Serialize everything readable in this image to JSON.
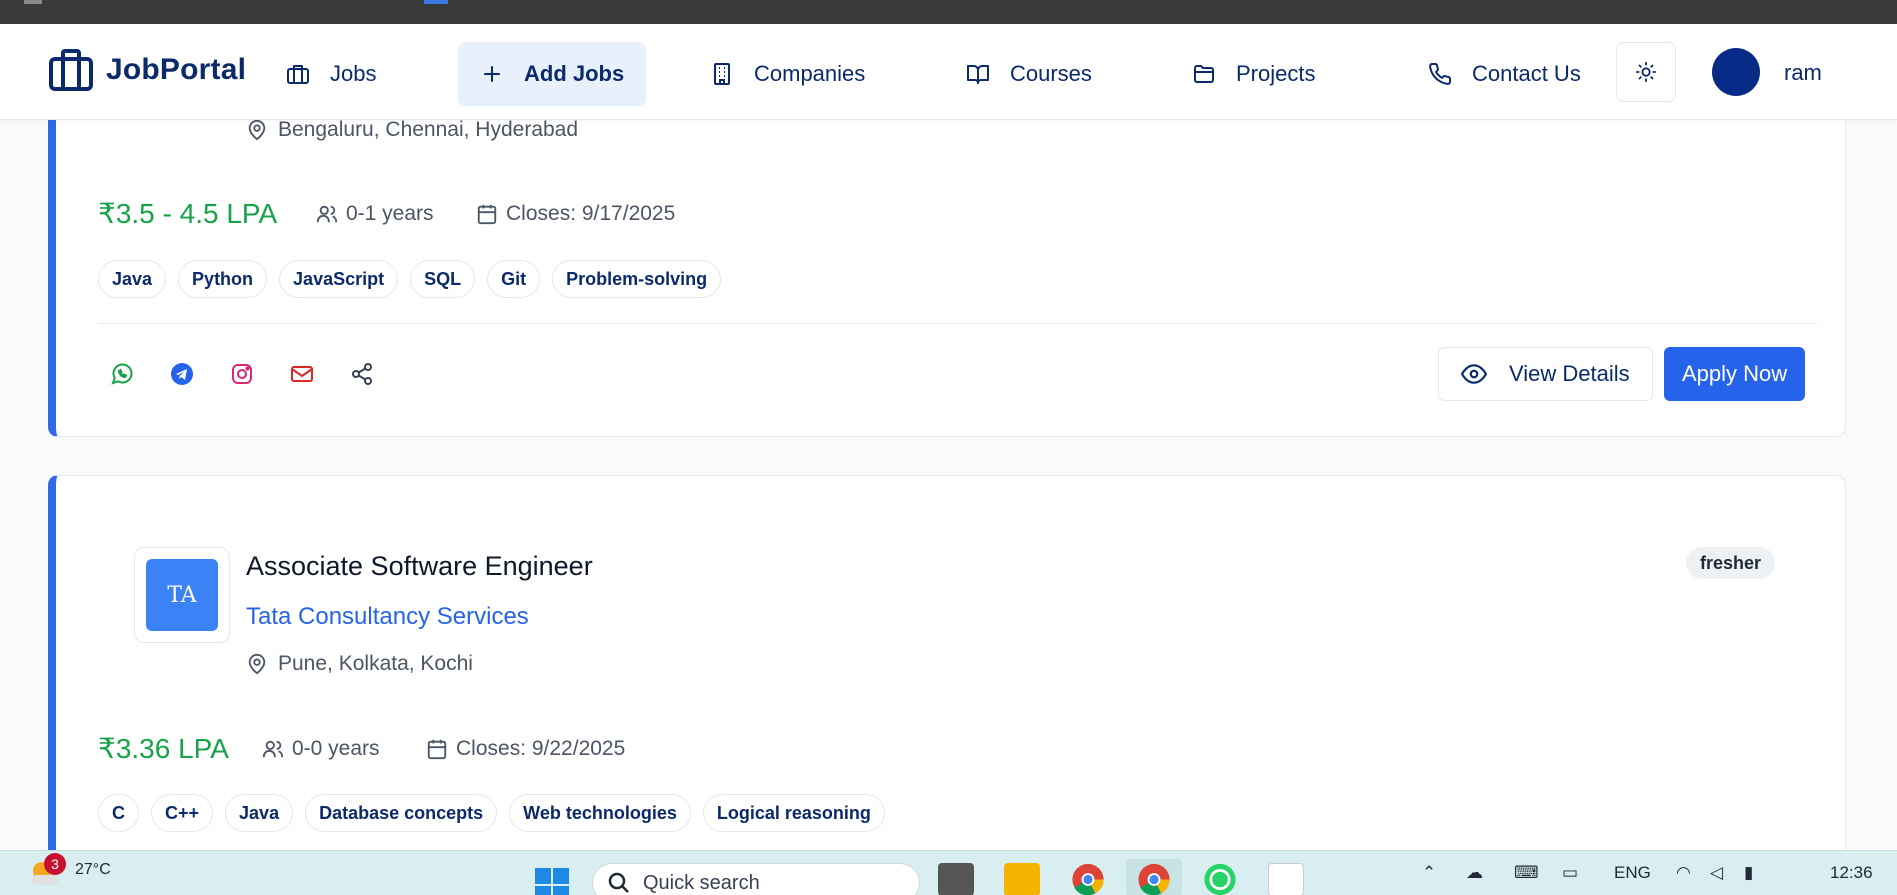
{
  "navbar": {
    "brand": "JobPortal",
    "items": [
      {
        "label": "Jobs",
        "icon": "briefcase-icon"
      },
      {
        "label": "Add Jobs",
        "icon": "plus-icon"
      },
      {
        "label": "Companies",
        "icon": "building-icon"
      },
      {
        "label": "Courses",
        "icon": "book-open-icon"
      },
      {
        "label": "Projects",
        "icon": "folder-icon"
      },
      {
        "label": "Contact Us",
        "icon": "phone-icon"
      }
    ],
    "user_name": "ram"
  },
  "job1": {
    "location": "Bengaluru, Chennai, Hyderabad",
    "salary": "₹3.5 - 4.5 LPA",
    "experience": "0-1 years",
    "closes": "Closes: 9/17/2025",
    "skills": [
      "Java",
      "Python",
      "JavaScript",
      "SQL",
      "Git",
      "Problem-solving"
    ],
    "view_label": "View Details",
    "apply_label": "Apply Now"
  },
  "job2": {
    "logo_text": "TA",
    "title": "Associate Software Engineer",
    "company": "Tata Consultancy Services",
    "location": "Pune, Kolkata, Kochi",
    "badge": "fresher",
    "salary": "₹3.36 LPA",
    "experience": "0-0 years",
    "closes": "Closes: 9/22/2025",
    "skills": [
      "C",
      "C++",
      "Java",
      "Database concepts",
      "Web technologies",
      "Logical reasoning"
    ]
  },
  "taskbar": {
    "notification_count": "3",
    "temperature": "27°C",
    "search_placeholder": "Quick search",
    "language": "ENG",
    "time": "12:36"
  },
  "colors": {
    "brand": "#0b2a6b",
    "accent": "#2563eb",
    "salary": "#17a34a",
    "card_border": "#2e6ae6"
  }
}
